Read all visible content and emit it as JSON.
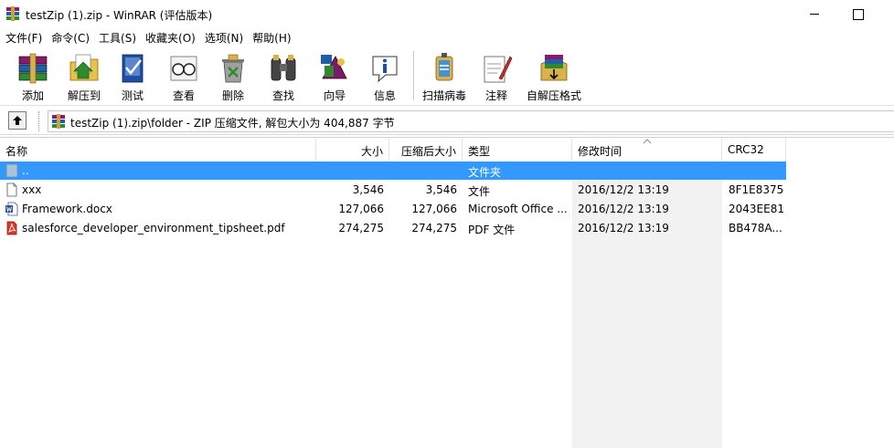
{
  "window": {
    "title": "testZip (1).zip - WinRAR (评估版本)",
    "app_icon": "winrar-books-icon"
  },
  "menu": [
    "文件(F)",
    "命令(C)",
    "工具(S)",
    "收藏夹(O)",
    "选项(N)",
    "帮助(H)"
  ],
  "toolbar": {
    "add": "添加",
    "extract": "解压到",
    "test": "测试",
    "view": "查看",
    "delete": "删除",
    "find": "查找",
    "wizard": "向导",
    "info": "信息",
    "scan": "扫描病毒",
    "comment": "注释",
    "sfx": "自解压格式"
  },
  "address": {
    "path": "testZip (1).zip\\folder - ZIP 压缩文件, 解包大小为 404,887 字节"
  },
  "columns": {
    "name": "名称",
    "size": "大小",
    "packed": "压缩后大小",
    "type": "类型",
    "modified": "修改时间",
    "crc": "CRC32"
  },
  "rows": [
    {
      "name": "..",
      "size": "",
      "packed": "",
      "type": "文件夹",
      "modified": "",
      "crc": "",
      "icon": "parent-folder-icon",
      "selected": true
    },
    {
      "name": "xxx",
      "size": "3,546",
      "packed": "3,546",
      "type": "文件",
      "modified": "2016/12/2 13:19",
      "crc": "8F1E8375",
      "icon": "blank-file-icon",
      "selected": false
    },
    {
      "name": "Framework.docx",
      "size": "127,066",
      "packed": "127,066",
      "type": "Microsoft Office ...",
      "modified": "2016/12/2 13:19",
      "crc": "2043EE81",
      "icon": "word-doc-icon",
      "selected": false
    },
    {
      "name": "salesforce_developer_environment_tipsheet.pdf",
      "size": "274,275",
      "packed": "274,275",
      "type": "PDF 文件",
      "modified": "2016/12/2 13:19",
      "crc": "BB478A...",
      "icon": "pdf-file-icon",
      "selected": false
    }
  ],
  "colors": {
    "selection": "#3399ff",
    "sorted_column_bg": "#f2f2f2"
  }
}
